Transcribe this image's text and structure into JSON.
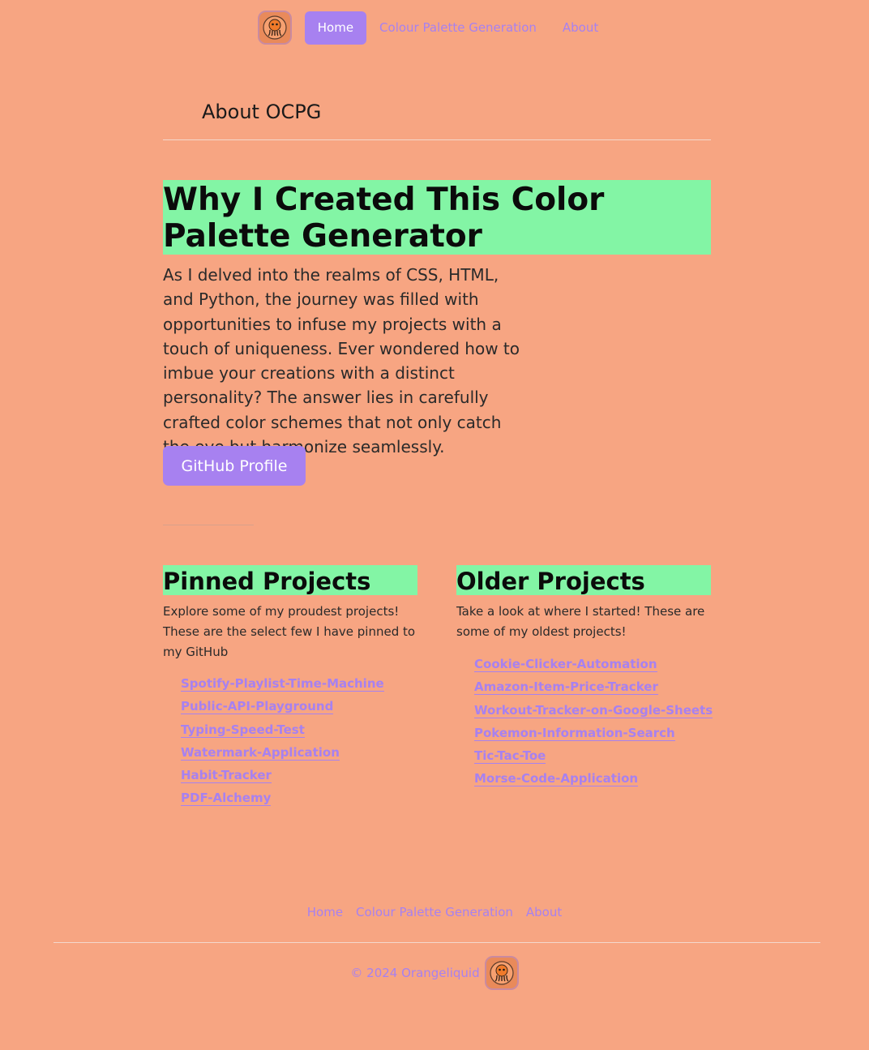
{
  "nav": {
    "logo_icon": "orange-octopus-logo",
    "items": [
      {
        "label": "Home",
        "active": true
      },
      {
        "label": "Colour Palette Generation",
        "active": false
      },
      {
        "label": "About",
        "active": false
      }
    ]
  },
  "page": {
    "title": "About OCPG",
    "headline": "Why I Created This Color Palette Generator",
    "lead": "As I delved into the realms of CSS, HTML, and Python, the journey was filled with opportunities to infuse my projects with a touch of uniqueness. Ever wondered how to imbue your creations with a distinct personality? The answer lies in carefully crafted color schemes that not only catch the eye but harmonize seamlessly.",
    "github_button": "GitHub Profile"
  },
  "pinned": {
    "heading": "Pinned Projects",
    "description": "Explore some of my proudest projects! These are the select few I have pinned to my GitHub",
    "projects": [
      "Spotify-Playlist-Time-Machine",
      "Public-API-Playground",
      "Typing-Speed-Test",
      "Watermark-Application",
      "Habit-Tracker",
      "PDF-Alchemy"
    ]
  },
  "older": {
    "heading": "Older Projects",
    "description": "Take a look at where I started! These are some of my oldest projects!",
    "projects": [
      "Cookie-Clicker-Automation",
      "Amazon-Item-Price-Tracker",
      "Workout-Tracker-on-Google-Sheets",
      "Pokemon-Information-Search",
      "Tic-Tac-Toe",
      "Morse-Code-Application"
    ]
  },
  "footer": {
    "nav": [
      "Home",
      "Colour Palette Generation",
      "About"
    ],
    "copyright": "© 2024 Orangeliquid"
  },
  "colors": {
    "background": "#f7a582",
    "accent": "#a781f0",
    "highlight": "#83f5a5"
  }
}
